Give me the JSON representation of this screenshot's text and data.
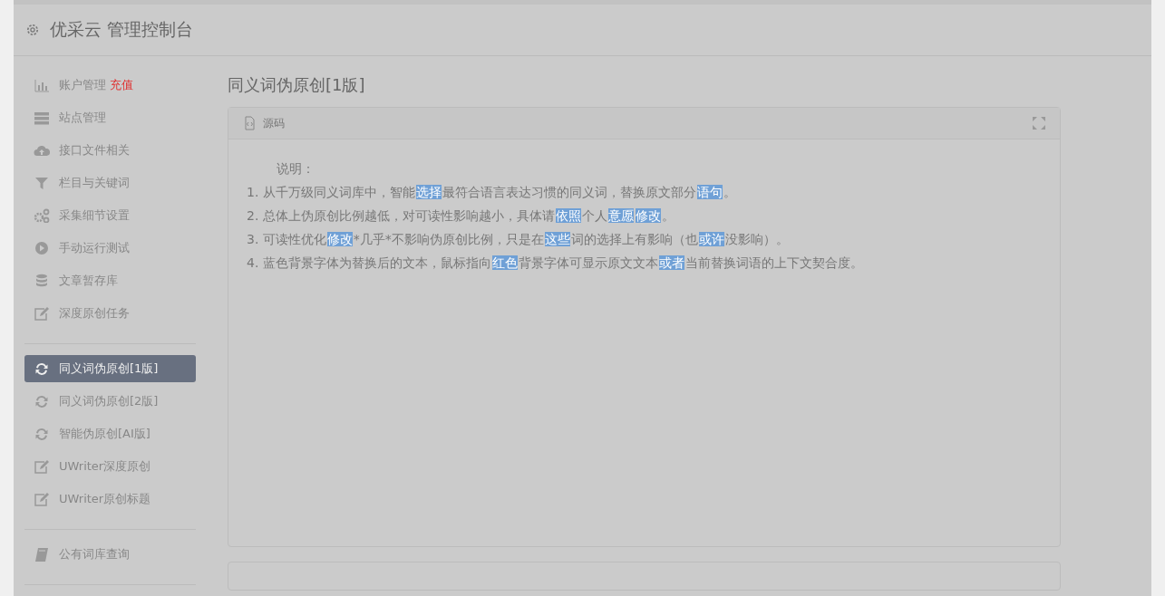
{
  "header": {
    "title": "优采云 管理控制台"
  },
  "sidebar": {
    "groups": [
      {
        "items": [
          {
            "label": "账户管理",
            "badge": "充值",
            "selected": false
          },
          {
            "label": "站点管理",
            "selected": false
          },
          {
            "label": "接口文件相关",
            "selected": false
          },
          {
            "label": "栏目与关键词",
            "selected": false
          },
          {
            "label": "采集细节设置",
            "selected": false
          },
          {
            "label": "手动运行测试",
            "selected": false
          },
          {
            "label": "文章暂存库",
            "selected": false
          },
          {
            "label": "深度原创任务",
            "selected": false
          }
        ]
      },
      {
        "items": [
          {
            "label": "同义词伪原创[1版]",
            "selected": true
          },
          {
            "label": "同义词伪原创[2版]",
            "selected": false
          },
          {
            "label": "智能伪原创[AI版]",
            "selected": false
          },
          {
            "label": "UWriter深度原创",
            "selected": false
          },
          {
            "label": "UWriter原创标题",
            "selected": false
          }
        ]
      },
      {
        "items": [
          {
            "label": "公有词库查询",
            "selected": false
          }
        ]
      }
    ]
  },
  "main": {
    "title": "同义词伪原创[1版]",
    "panel": {
      "title": "源码",
      "heading": "说明：",
      "lines": [
        [
          {
            "text": "1. 从千万级同义词库中，智能",
            "highlighted": false
          },
          {
            "text": "选择",
            "highlighted": true
          },
          {
            "text": "最符合语言表达习惯的同义词，替换原文部分",
            "highlighted": false
          },
          {
            "text": "语句",
            "highlighted": true
          },
          {
            "text": "。",
            "highlighted": false
          }
        ],
        [
          {
            "text": "2. 总体上伪原创比例越低，对可读性影响越小，具体请",
            "highlighted": false
          },
          {
            "text": "依照",
            "highlighted": true
          },
          {
            "text": "个人",
            "highlighted": false
          },
          {
            "text": "意愿",
            "highlighted": true
          },
          {
            "text": "修改",
            "highlighted": true
          },
          {
            "text": "。",
            "highlighted": false
          }
        ],
        [
          {
            "text": "3. 可读性优化",
            "highlighted": false
          },
          {
            "text": "修改",
            "highlighted": true
          },
          {
            "text": "*几乎*不影响伪原创比例，只是在",
            "highlighted": false
          },
          {
            "text": "这些",
            "highlighted": true
          },
          {
            "text": "词的选择上有影响（也",
            "highlighted": false
          },
          {
            "text": "或许",
            "highlighted": true
          },
          {
            "text": "没影响）。",
            "highlighted": false
          }
        ],
        [
          {
            "text": "4. 蓝色背景字体为替换后的文本，鼠标指向",
            "highlighted": false
          },
          {
            "text": "红色",
            "highlighted": true
          },
          {
            "text": "背景字体可显示原文文本",
            "highlighted": false
          },
          {
            "text": "或者",
            "highlighted": true
          },
          {
            "text": "当前替换词语的上下文契合度。",
            "highlighted": false
          }
        ]
      ]
    }
  }
}
